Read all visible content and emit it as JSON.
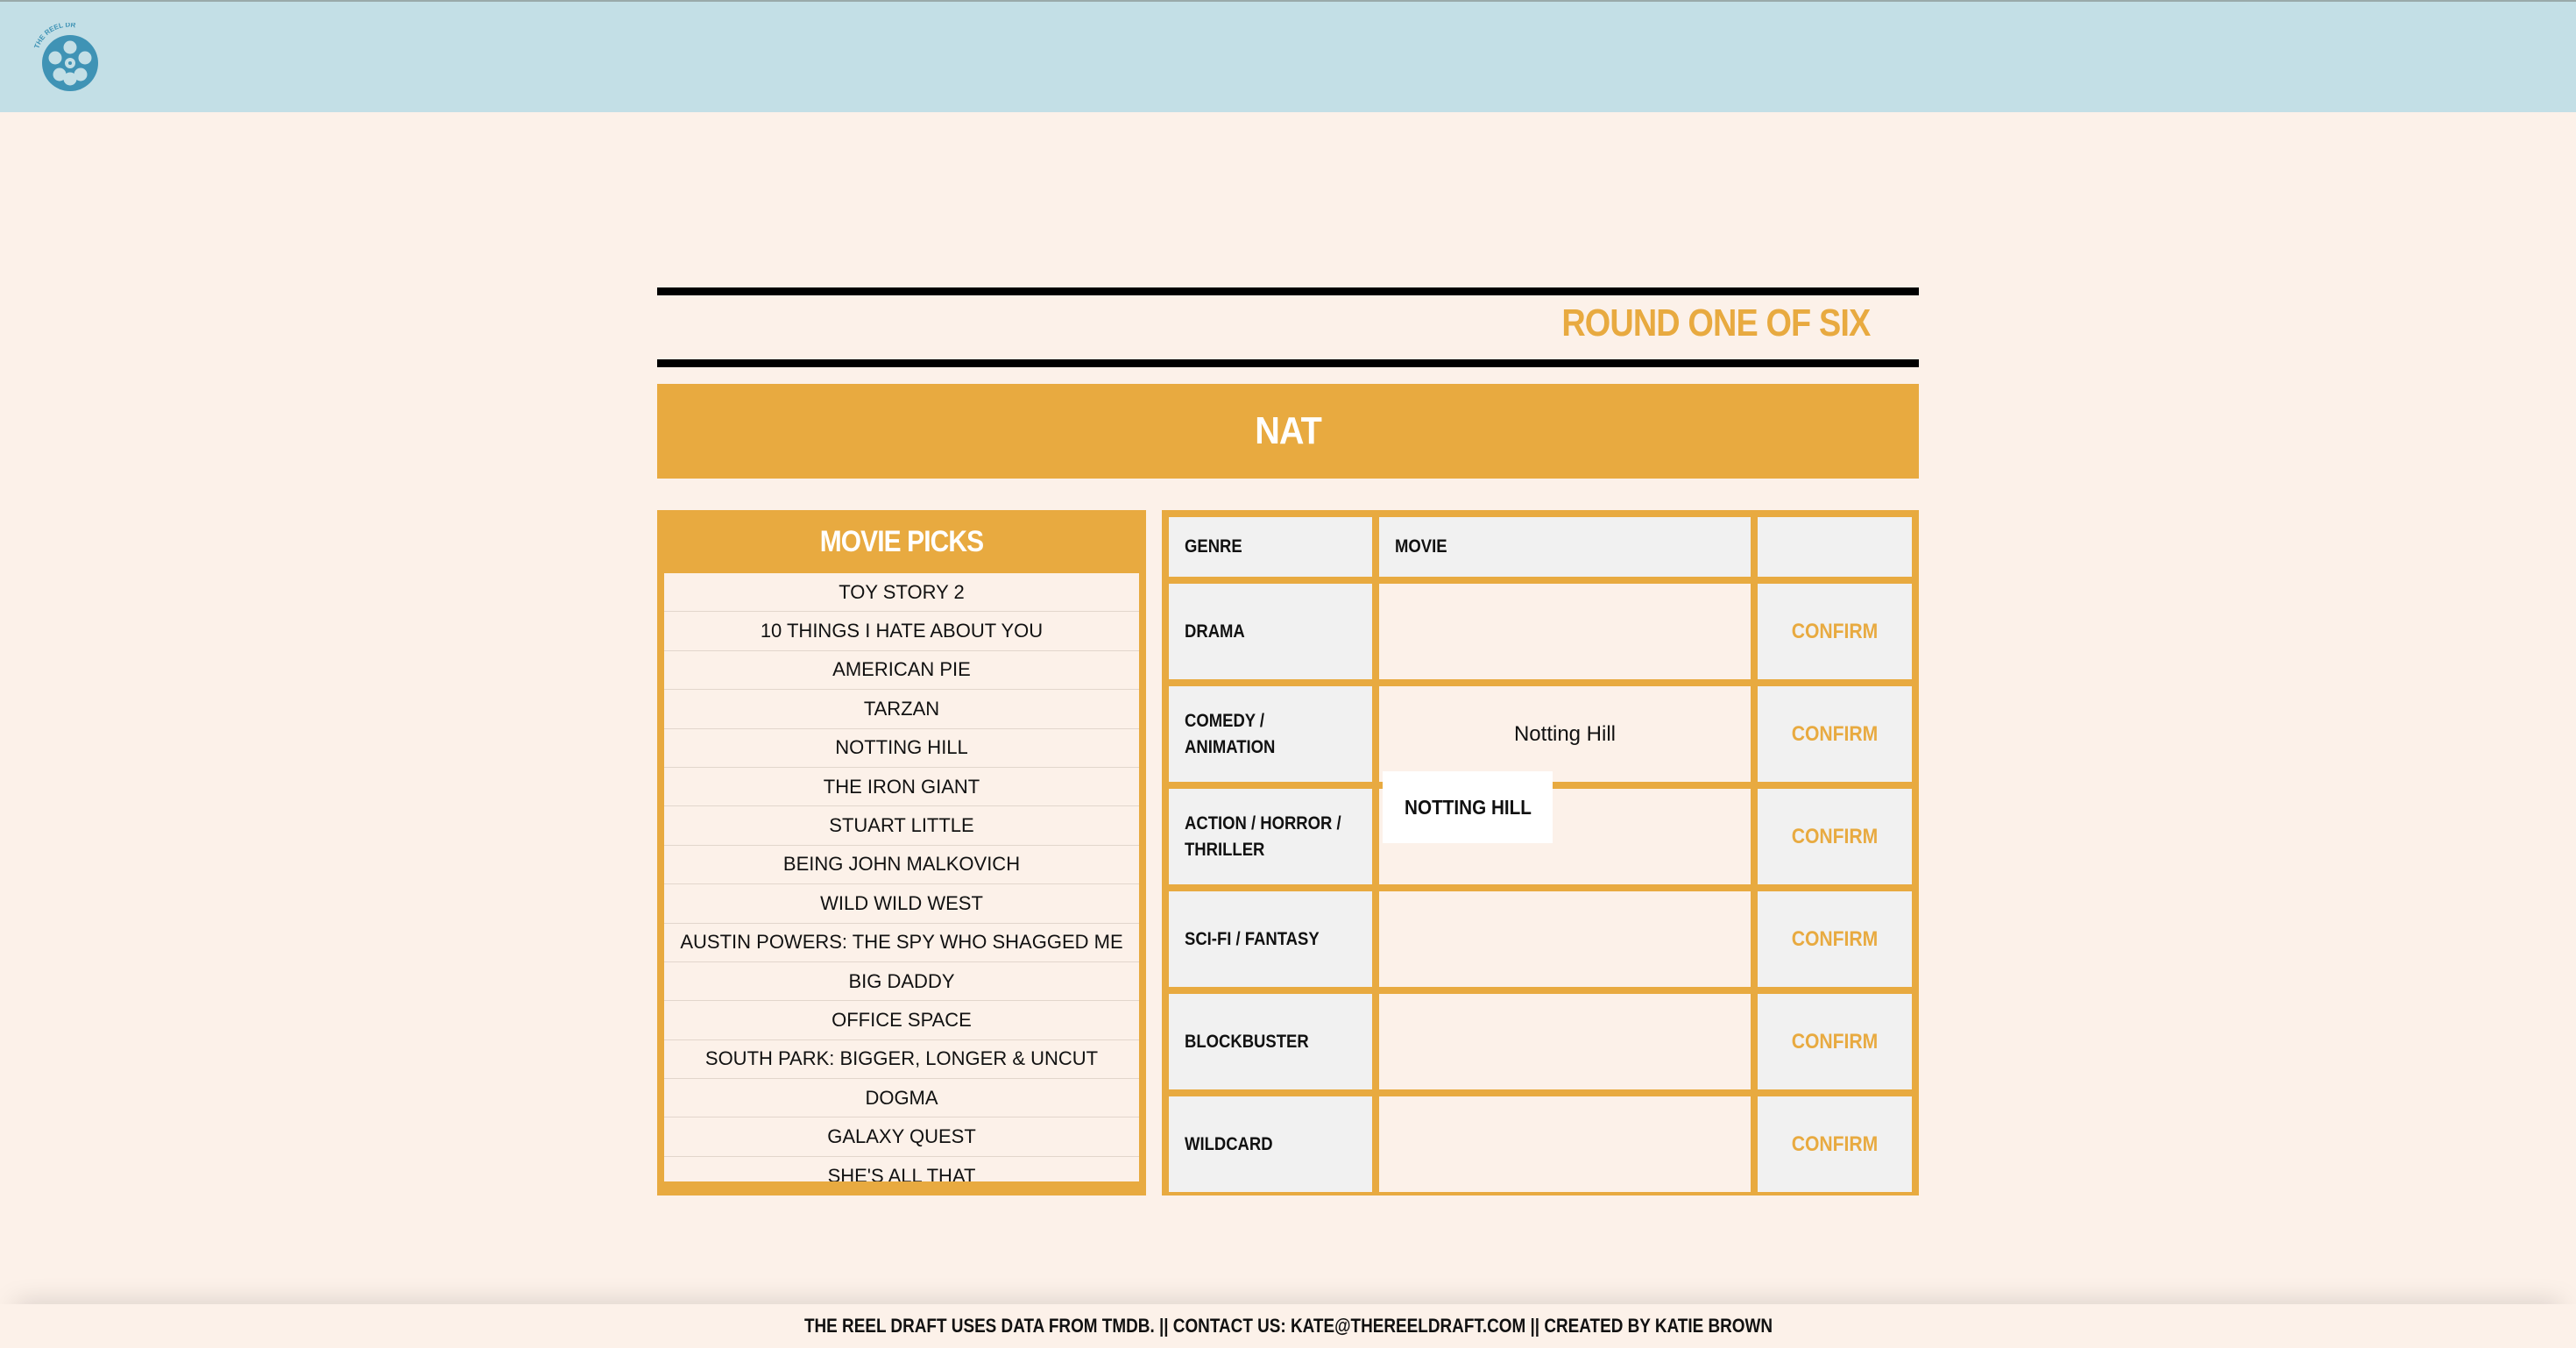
{
  "header": {
    "logo_icon": "film-reel-icon",
    "logo_text": "THE REEL DRAFT",
    "background_color": "#c3dfe6"
  },
  "round": {
    "title": "ROUND ONE OF SIX",
    "accent_color": "#e8aa40"
  },
  "player": {
    "name": "NAT"
  },
  "movie_picks": {
    "title": "MOVIE PICKS",
    "items": [
      "TOY STORY 2",
      "10 THINGS I HATE ABOUT YOU",
      "AMERICAN PIE",
      "TARZAN",
      "NOTTING HILL",
      "THE IRON GIANT",
      "STUART LITTLE",
      "BEING JOHN MALKOVICH",
      "WILD WILD WEST",
      "AUSTIN POWERS: THE SPY WHO SHAGGED ME",
      "BIG DADDY",
      "OFFICE SPACE",
      "SOUTH PARK: BIGGER, LONGER & UNCUT",
      "DOGMA",
      "GALAXY QUEST",
      "SHE'S ALL THAT"
    ]
  },
  "board": {
    "headers": {
      "genre": "GENRE",
      "movie": "MOVIE",
      "action": ""
    },
    "rows": [
      {
        "genre": "DRAMA",
        "movie": "",
        "confirm": "CONFIRM"
      },
      {
        "genre": "COMEDY / ANIMATION",
        "movie": "Notting Hill",
        "confirm": "CONFIRM"
      },
      {
        "genre": "ACTION / HORROR / THRILLER",
        "movie": "",
        "confirm": "CONFIRM"
      },
      {
        "genre": "SCI-FI / FANTASY",
        "movie": "",
        "confirm": "CONFIRM"
      },
      {
        "genre": "BLOCKBUSTER",
        "movie": "",
        "confirm": "CONFIRM"
      },
      {
        "genre": "WILDCARD",
        "movie": "",
        "confirm": "CONFIRM"
      }
    ]
  },
  "drag_ghost": {
    "label": "NOTTING HILL"
  },
  "footer": {
    "text": "THE REEL DRAFT USES DATA FROM TMDB. || CONTACT US: KATE@THEREELDRAFT.COM || CREATED BY KATIE BROWN"
  }
}
